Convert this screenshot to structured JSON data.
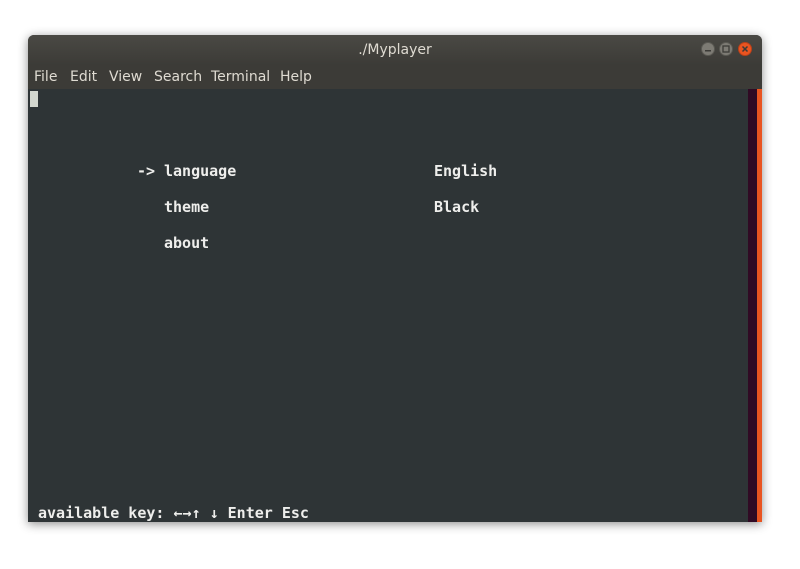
{
  "window": {
    "title": "./Myplayer"
  },
  "menu": {
    "file": "File",
    "edit": "Edit",
    "view": "View",
    "search": "Search",
    "terminal": "Terminal",
    "help": "Help"
  },
  "settings": {
    "pointer": "->",
    "rows": [
      {
        "label": "language",
        "value": "English"
      },
      {
        "label": "theme",
        "value": "Black"
      },
      {
        "label": "about",
        "value": ""
      }
    ]
  },
  "footer": {
    "hint": "available key: ←→↑ ↓ Enter Esc"
  },
  "colors": {
    "terminal_bg": "#2e3436",
    "chrome_bg": "#3c3b37",
    "accent": "#e95420",
    "scroll_track": "#300a24"
  }
}
